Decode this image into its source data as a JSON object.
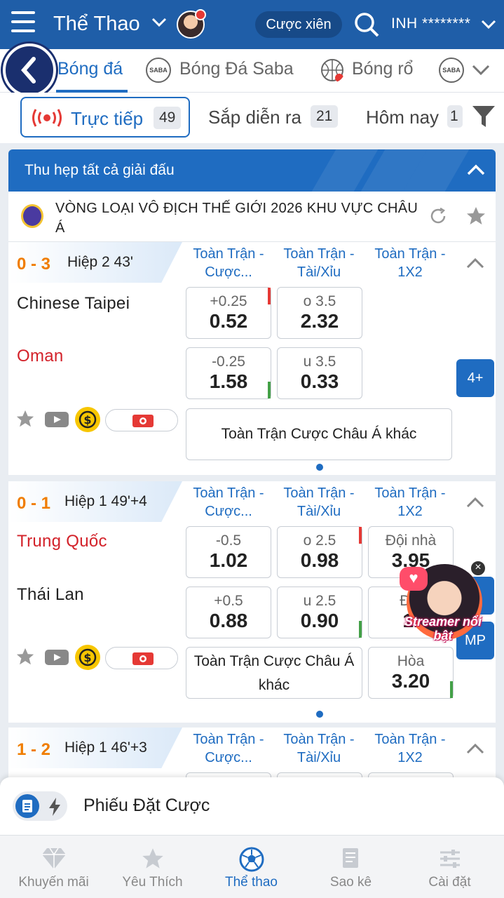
{
  "header": {
    "sport_title": "Thể Thao",
    "parlay_label": "Cược xiên",
    "username": "INH ********"
  },
  "sport_tabs": [
    {
      "label": "Bóng đá",
      "active": true
    },
    {
      "label": "Bóng Đá Saba",
      "active": false
    },
    {
      "label": "Bóng rổ",
      "active": false
    }
  ],
  "filters": {
    "live": {
      "label": "Trực tiếp",
      "count": "49"
    },
    "upcoming": {
      "label": "Sắp diễn ra",
      "count": "21"
    },
    "today": {
      "label": "Hôm nay",
      "count": "1"
    }
  },
  "collapse_label": "Thu hẹp tất cả giải đấu",
  "league": {
    "name": "VÒNG LOẠI VÔ ĐỊCH THẾ GIỚI 2026 KHU VỰC CHÂU Á"
  },
  "column_headers": [
    "Toàn Trận - Cược...",
    "Toàn Trận - Tài/Xỉu",
    "Toàn Trận - 1X2"
  ],
  "matches": [
    {
      "score": "0 - 3",
      "period": "Hiệp 2 43'",
      "home": "Chinese Taipei",
      "away": "Oman",
      "hdp_home": {
        "line": "+0.25",
        "price": "0.52"
      },
      "hdp_away": {
        "line": "-0.25",
        "price": "1.58"
      },
      "ou_over": {
        "line": "o 3.5",
        "price": "2.32"
      },
      "ou_under": {
        "line": "u 3.5",
        "price": "0.33"
      },
      "more": "4+",
      "other_markets": "Toàn Trận Cược Châu Á khác"
    },
    {
      "score": "0 - 1",
      "period": "Hiệp 1 49'+4",
      "home": "Trung Quốc",
      "away": "Thái Lan",
      "hdp_home": {
        "line": "-0.5",
        "price": "1.02"
      },
      "hdp_away": {
        "line": "+0.5",
        "price": "0.88"
      },
      "ou_over": {
        "line": "o 2.5",
        "price": "0.98"
      },
      "ou_under": {
        "line": "u 2.5",
        "price": "0.90"
      },
      "x12_home": {
        "line": "Đội nhà",
        "price": "3.95"
      },
      "x12_away": {
        "line": "Đội",
        "price": "1."
      },
      "x12_draw": {
        "line": "Hòa",
        "price": "3.20"
      },
      "more_partial": "+",
      "cmp_partial": "MP",
      "other_markets": "Toàn Trận Cược Châu Á khác"
    },
    {
      "score": "1 - 2",
      "period": "Hiệp 1 46'+3"
    }
  ],
  "streamer": {
    "label": "Streamer nổi bật",
    "close": "×"
  },
  "betslip": {
    "label": "Phiếu Đặt Cược"
  },
  "bottom_nav": [
    {
      "label": "Khuyến mãi",
      "icon": "diamond-icon"
    },
    {
      "label": "Yêu Thích",
      "icon": "star-icon"
    },
    {
      "label": "Thể thao",
      "icon": "soccer-ball-icon",
      "active": true
    },
    {
      "label": "Sao kê",
      "icon": "statement-icon"
    },
    {
      "label": "Cài đặt",
      "icon": "settings-icon"
    }
  ],
  "colors": {
    "header_bg": "#1f5ea8",
    "accent": "#1f6cc1",
    "score": "#f07d00",
    "home_red": "#d3222a"
  }
}
